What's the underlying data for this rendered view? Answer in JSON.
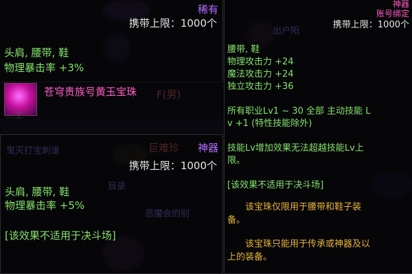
{
  "top_left": {
    "rarity": "稀有",
    "capacity": "携带上限：1000个",
    "slots": "头肩, 腰带, 鞋",
    "stat": "物理暴击率 +3%"
  },
  "middle_item": {
    "name": "苍穹贵族号黄玉宝珠",
    "icon": "purple-orb-icon"
  },
  "bottom_left": {
    "rarity": "神器",
    "capacity": "携带上限：1000个",
    "slots": "头肩, 腰带, 鞋",
    "stat": "物理暴击率 +5%",
    "note": "[该效果不适用于决斗场]"
  },
  "right": {
    "rarity": "神器",
    "binding": "账号绑定",
    "capacity": "携带上限：1000个",
    "slots": "腰带, 鞋",
    "stats": [
      "物理攻击力 +24",
      "魔法攻击力 +24",
      "独立攻击力 +36"
    ],
    "skill_1": "所有职业Lv1 ~ 30 全部 主动技能 L",
    "skill_2": "v +1 (特性技能除外)",
    "desc_1": "技能Lv增加效果无法超越技能Lv上",
    "desc_2": "限。",
    "note": "[该效果不适用于决斗场]",
    "usage_1": "该宝珠仅限用于腰带和鞋子装",
    "usage_2": "备。",
    "usage_3": "该宝珠只能用于传承或神器及以",
    "usage_4": "上的装备。"
  },
  "colors": {
    "white": "#e6e6e6",
    "green": "#86e36a",
    "purple": "#b46cff",
    "pink": "#ff5cc2",
    "gold": "#e8b33a"
  }
}
